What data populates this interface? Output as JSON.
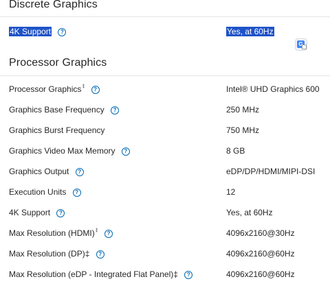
{
  "discrete": {
    "title": "Discrete Graphics",
    "rows": [
      {
        "label": "4K Support",
        "value": "Yes, at 60Hz"
      }
    ]
  },
  "processor": {
    "title": "Processor Graphics",
    "rows": [
      {
        "label": "Processor Graphics",
        "footnote": "‡",
        "value": "Intel® UHD Graphics 600"
      },
      {
        "label": "Graphics Base Frequency",
        "value": "250 MHz"
      },
      {
        "label": "Graphics Burst Frequency",
        "value": "750 MHz"
      },
      {
        "label": "Graphics Video Max Memory",
        "value": "8 GB"
      },
      {
        "label": "Graphics Output",
        "value": "eDP/DP/HDMI/MIPI-DSI"
      },
      {
        "label": "Execution Units",
        "value": "12"
      },
      {
        "label": "4K Support",
        "value": "Yes, at 60Hz"
      },
      {
        "label": "Max Resolution (HDMI)",
        "footnote": "‡",
        "value": "4096x2160@30Hz"
      },
      {
        "label": "Max Resolution (DP)‡",
        "value": "4096x2160@60Hz"
      },
      {
        "label": "Max Resolution (eDP - Integrated Flat Panel)‡",
        "value": "4096x2160@60Hz"
      }
    ]
  },
  "icons": {
    "help": "?",
    "translate": "G"
  },
  "colors": {
    "selection": "#1f53c8",
    "link": "#0068b5"
  }
}
